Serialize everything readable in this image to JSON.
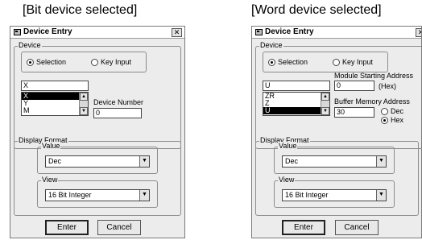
{
  "captions": {
    "left": "[Bit device selected]",
    "right": "[Word device selected]"
  },
  "dialog": {
    "title": "Device Entry",
    "close_glyph": "✕",
    "device_group_label": "Device",
    "radio_selection": "Selection",
    "radio_key_input": "Key Input",
    "display_format_label": "Display Format",
    "value_label": "Value",
    "view_label": "View",
    "enter_label": "Enter",
    "cancel_label": "Cancel",
    "up_glyph": "▲",
    "down_glyph": "▼"
  },
  "bit": {
    "device_input": "X",
    "list_items": [
      "X",
      "Y",
      "M"
    ],
    "selected_item": "X",
    "device_number_label": "Device Number",
    "device_number": "0",
    "value": "Dec",
    "view": "16 Bit Integer"
  },
  "word": {
    "device_input": "U",
    "list_items": [
      "ZR",
      "Z",
      "U"
    ],
    "selected_item": "U",
    "module_address_label": "Module Starting Address",
    "module_address": "0",
    "hex_suffix": "(Hex)",
    "buffer_label": "Buffer Memory Address",
    "buffer_address": "30",
    "radio_dec": "Dec",
    "radio_hex": "Hex",
    "selected_radix": "Hex",
    "value": "Dec",
    "view": "16 Bit Integer"
  }
}
